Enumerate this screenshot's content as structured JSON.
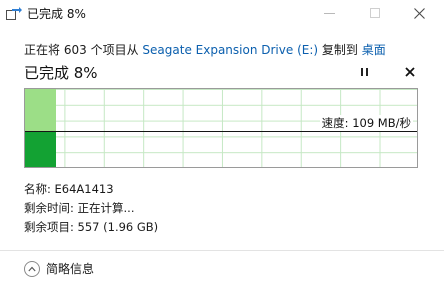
{
  "window": {
    "title": "已完成 8%"
  },
  "status": {
    "prefix": "正在将",
    "count": "603",
    "items_word": "个项目从",
    "source": "Seagate Expansion Drive (E:)",
    "verb": "复制到",
    "destination": "桌面"
  },
  "progress": {
    "heading": "已完成 8%",
    "percent": 8,
    "speed_label": "速度: 109 MB/秒"
  },
  "details": {
    "name_label": "名称:",
    "name_value": "E64A1413",
    "time_label": "剩余时间:",
    "time_value": "正在计算...",
    "items_label": "剩余项目:",
    "items_value": "557 (1.96 GB)"
  },
  "footer": {
    "collapse_label": "简略信息"
  },
  "icons": [
    "copy-icon",
    "minimize-icon",
    "maximize-icon",
    "close-icon",
    "pause-icon",
    "cancel-icon",
    "chevron-up-icon"
  ],
  "colors": {
    "link": "#0b5fae",
    "progress_light": "#9cde87",
    "progress_dark": "#13a233",
    "grid": "#c5e8c4"
  }
}
